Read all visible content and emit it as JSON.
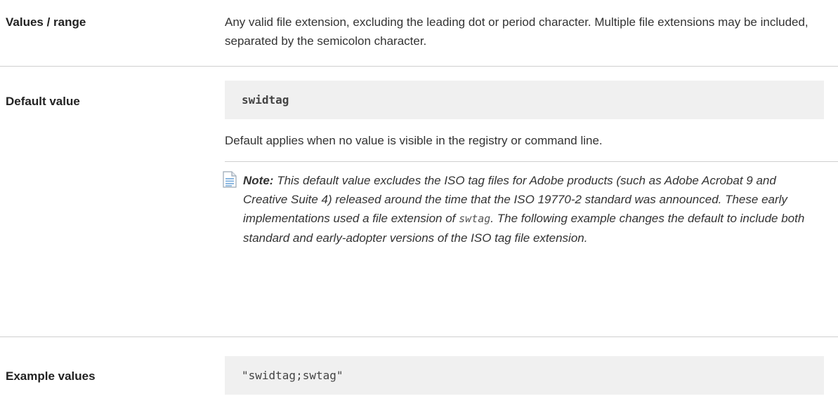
{
  "rows": {
    "values_range": {
      "label": "Values / range",
      "text": "Any valid file extension, excluding the leading dot or period character. Multiple file extensions may be included, separated by the semicolon character."
    },
    "default_value": {
      "label": "Default value",
      "code": "swidtag",
      "text": "Default applies when no value is visible in the registry or command line.",
      "note": {
        "icon": "document-note-icon",
        "label": "Note:",
        "text_before": "This default value excludes the ISO tag files for Adobe products (such as Adobe Acrobat 9 and Creative Suite 4) released around the time that the ISO 19770-2 standard was announced. These early implementations used a file extension of",
        "code": "swtag",
        "text_after": ". The following example changes the default to include both standard and early-adopter versions of the ISO tag file extension."
      }
    },
    "example_values": {
      "label": "Example values",
      "code": "\"swidtag;swtag\""
    }
  }
}
